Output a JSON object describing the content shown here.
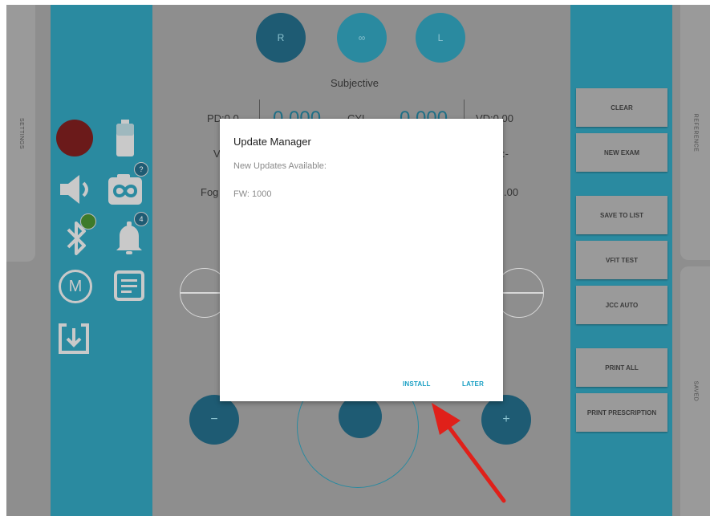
{
  "side_tabs": {
    "settings": "SETTINGS",
    "reference": "REFERENCE",
    "saved": "SAVED"
  },
  "eyes": {
    "right": "R",
    "both": "∞",
    "left": "L"
  },
  "exam": {
    "mode": "Subjective",
    "pd_label": "PD:0.0",
    "vd_label": "VD:0.00",
    "sph_value": "0.000",
    "cyl_value": "0.000",
    "cyl_label": "CYL",
    "v_label": "V",
    "fog_label": "Fog",
    "dash": ":-",
    "right_value": ".00"
  },
  "left_icons": {
    "camera_badge": "?",
    "bell_badge": "4",
    "m_label": "M"
  },
  "right_buttons": [
    "CLEAR",
    "NEW EXAM",
    "SAVE TO LIST",
    "VFIT TEST",
    "JCC AUTO",
    "PRINT ALL",
    "PRINT PRESCRIPTION"
  ],
  "controls": {
    "minus": "−",
    "plus": "+"
  },
  "dialog": {
    "title": "Update Manager",
    "subtitle": "New Updates Available:",
    "fw": "FW: 1000",
    "install": "INSTALL",
    "later": "LATER"
  },
  "colors": {
    "teal": "#2a8aa0",
    "dialog_accent": "#1aa0c4",
    "arrow": "#e0201a",
    "record": "#6b1a1a"
  }
}
